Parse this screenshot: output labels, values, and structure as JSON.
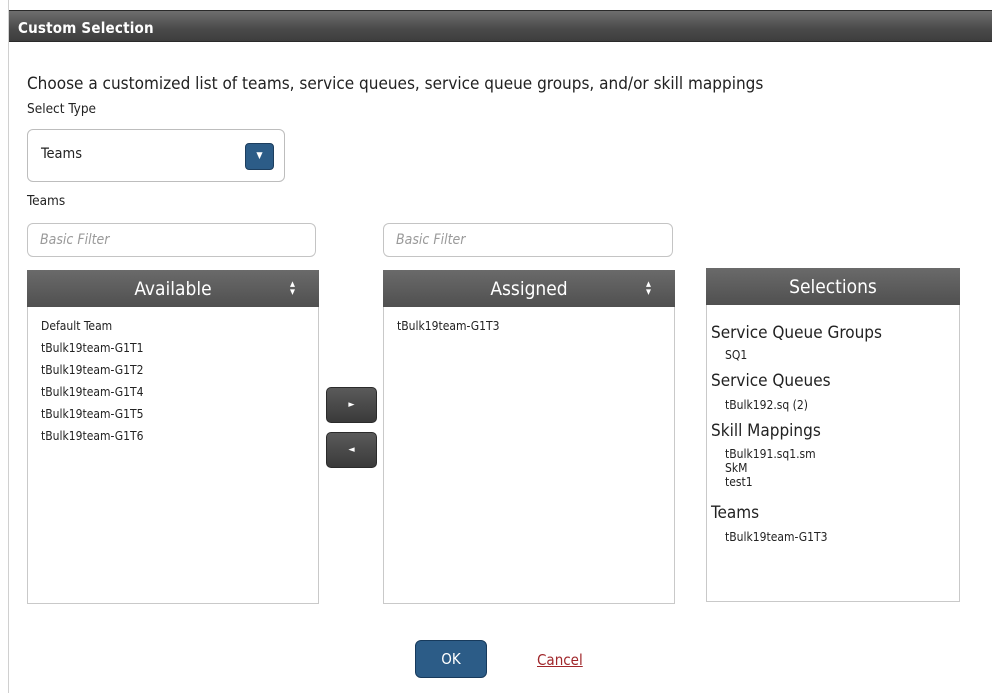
{
  "dialog": {
    "title": "Custom Selection",
    "intro": "Choose a customized list of teams, service queues, service queue groups, and/or skill mappings",
    "select_type_label": "Select Type",
    "select_type_value": "Teams",
    "list_label": "Teams"
  },
  "available": {
    "filter_placeholder": "Basic Filter",
    "header": "Available",
    "items": [
      "Default Team",
      "tBulk19team-G1T1",
      "tBulk19team-G1T2",
      "tBulk19team-G1T4",
      "tBulk19team-G1T5",
      "tBulk19team-G1T6"
    ]
  },
  "assigned": {
    "filter_placeholder": "Basic Filter",
    "header": "Assigned",
    "items": [
      "tBulk19team-G1T3"
    ]
  },
  "move_buttons": {
    "right_icon": "triangle-right-icon",
    "left_icon": "triangle-left-icon"
  },
  "selections": {
    "header": "Selections",
    "groups": [
      {
        "title": "Service Queue Groups",
        "items": [
          "SQ1"
        ]
      },
      {
        "title": "Service Queues",
        "items": [
          "tBulk192.sq (2)"
        ]
      },
      {
        "title": "Skill Mappings",
        "items": [
          "tBulk191.sq1.sm",
          "SkM",
          "test1"
        ]
      },
      {
        "title": "Teams",
        "items": [
          "tBulk19team-G1T3"
        ]
      }
    ]
  },
  "footer": {
    "ok_label": "OK",
    "cancel_label": "Cancel"
  },
  "colors": {
    "primary_button": "#2c5c87",
    "cancel_link": "#a0262a",
    "header_dark": "#505050"
  }
}
